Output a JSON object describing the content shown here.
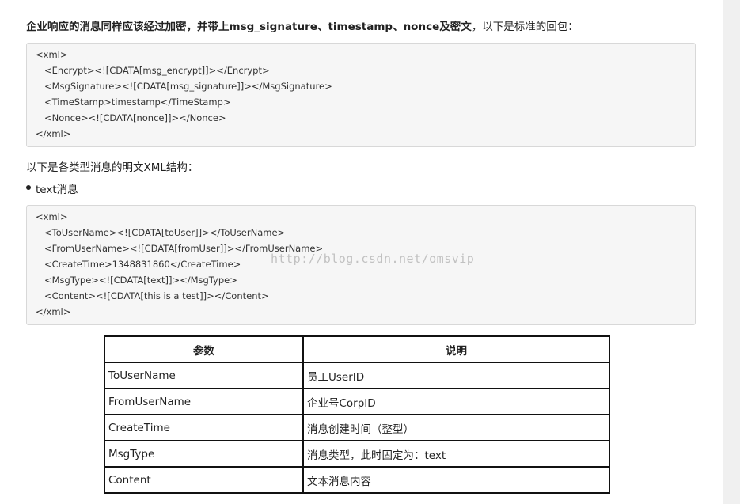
{
  "intro": {
    "bold_text": "企业响应的消息同样应该经过加密，并带上msg_signature、timestamp、nonce及密文",
    "rest_text": "，以下是标准的回包："
  },
  "code_block_1": {
    "lines": [
      "<xml>",
      "<Encrypt><![CDATA[msg_encrypt]]></Encrypt>",
      "<MsgSignature><![CDATA[msg_signature]]></MsgSignature>",
      "<TimeStamp>timestamp</TimeStamp>",
      "<Nonce><![CDATA[nonce]]></Nonce>",
      "</xml>"
    ]
  },
  "paragraph": "以下是各类型消息的明文XML结构：",
  "bullet": "text消息",
  "code_block_2": {
    "lines": [
      "<xml>",
      "<ToUserName><![CDATA[toUser]]></ToUserName>",
      "<FromUserName><![CDATA[fromUser]]></FromUserName>",
      "<CreateTime>1348831860</CreateTime>",
      "<MsgType><![CDATA[text]]></MsgType>",
      "<Content><![CDATA[this is a test]]></Content>",
      "</xml>"
    ]
  },
  "watermark": "http://blog.csdn.net/omsvip",
  "table": {
    "headers": [
      "参数",
      "说明"
    ],
    "rows": [
      [
        "ToUserName",
        "员工UserID"
      ],
      [
        "FromUserName",
        "企业号CorpID"
      ],
      [
        "CreateTime",
        "消息创建时间（整型）"
      ],
      [
        "MsgType",
        "消息类型，此时固定为：text"
      ],
      [
        "Content",
        "文本消息内容"
      ]
    ]
  }
}
